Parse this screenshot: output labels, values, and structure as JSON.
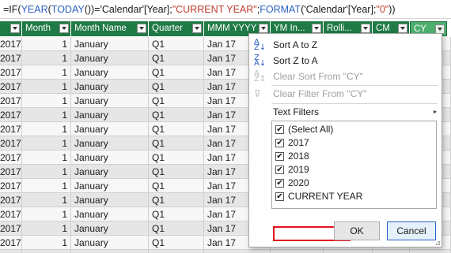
{
  "formula": {
    "parts": [
      {
        "text": "=IF(",
        "kind": "plain"
      },
      {
        "text": "YEAR",
        "kind": "fn"
      },
      {
        "text": "(",
        "kind": "plain"
      },
      {
        "text": "TODAY",
        "kind": "fn"
      },
      {
        "text": "())='Calendar'[Year];",
        "kind": "plain"
      },
      {
        "text": "\"CURRENT YEAR\"",
        "kind": "str"
      },
      {
        "text": "; ",
        "kind": "plain"
      },
      {
        "text": "FORMAT",
        "kind": "fn"
      },
      {
        "text": "('Calendar'[Year]; ",
        "kind": "plain"
      },
      {
        "text": "\"0\"",
        "kind": "str"
      },
      {
        "text": "))",
        "kind": "plain"
      }
    ]
  },
  "columns": [
    "",
    "Month",
    "Month Name",
    "Quarter",
    "MMM YYYY",
    "YM In...",
    "Rolli...",
    "CM",
    "CY"
  ],
  "rows": [
    {
      "year": "2017",
      "month": "1",
      "name": "January",
      "quarter": "Q1",
      "mmm": "Jan 17"
    },
    {
      "year": "2017",
      "month": "1",
      "name": "January",
      "quarter": "Q1",
      "mmm": "Jan 17"
    },
    {
      "year": "2017",
      "month": "1",
      "name": "January",
      "quarter": "Q1",
      "mmm": "Jan 17"
    },
    {
      "year": "2017",
      "month": "1",
      "name": "January",
      "quarter": "Q1",
      "mmm": "Jan 17"
    },
    {
      "year": "2017",
      "month": "1",
      "name": "January",
      "quarter": "Q1",
      "mmm": "Jan 17"
    },
    {
      "year": "2017",
      "month": "1",
      "name": "January",
      "quarter": "Q1",
      "mmm": "Jan 17"
    },
    {
      "year": "2017",
      "month": "1",
      "name": "January",
      "quarter": "Q1",
      "mmm": "Jan 17"
    },
    {
      "year": "2017",
      "month": "1",
      "name": "January",
      "quarter": "Q1",
      "mmm": "Jan 17"
    },
    {
      "year": "2017",
      "month": "1",
      "name": "January",
      "quarter": "Q1",
      "mmm": "Jan 17"
    },
    {
      "year": "2017",
      "month": "1",
      "name": "January",
      "quarter": "Q1",
      "mmm": "Jan 17"
    },
    {
      "year": "2017",
      "month": "1",
      "name": "January",
      "quarter": "Q1",
      "mmm": "Jan 17"
    },
    {
      "year": "2017",
      "month": "1",
      "name": "January",
      "quarter": "Q1",
      "mmm": "Jan 17"
    },
    {
      "year": "2017",
      "month": "1",
      "name": "January",
      "quarter": "Q1",
      "mmm": "Jan 17"
    },
    {
      "year": "2017",
      "month": "1",
      "name": "January",
      "quarter": "Q1",
      "mmm": "Jan 17"
    },
    {
      "year": "2017",
      "month": "1",
      "name": "January",
      "quarter": "Q1",
      "mmm": "Jan 17"
    },
    {
      "year": "2017",
      "month": "1",
      "name": "January",
      "quarter": "Q1",
      "mmm": "Jan 17"
    }
  ],
  "filter_menu": {
    "sort_az": "Sort A to Z",
    "sort_za": "Sort Z to A",
    "clear_sort": "Clear Sort From \"CY\"",
    "clear_filter": "Clear Filter From \"CY\"",
    "text_filters": "Text Filters",
    "items": [
      {
        "label": "(Select All)",
        "checked": true
      },
      {
        "label": "2017",
        "checked": true
      },
      {
        "label": "2018",
        "checked": true
      },
      {
        "label": "2019",
        "checked": true
      },
      {
        "label": "2020",
        "checked": true
      },
      {
        "label": "CURRENT YEAR",
        "checked": true
      }
    ],
    "ok_label": "OK",
    "cancel_label": "Cancel"
  },
  "colors": {
    "header_green": "#1f7a45",
    "active_header": "#4caf6e",
    "highlight_red": "#e0141e",
    "function_blue": "#2b62c0",
    "string_red": "#c0392b"
  }
}
